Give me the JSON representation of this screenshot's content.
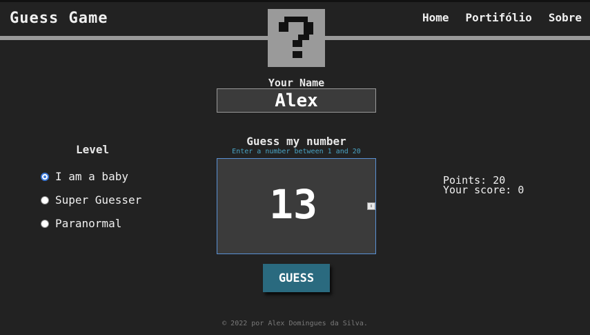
{
  "header": {
    "brand": "Guess Game",
    "logo_icon": "question-mark-icon",
    "nav": [
      {
        "label": "Home"
      },
      {
        "label": "Portifólio"
      },
      {
        "label": "Sobre"
      }
    ]
  },
  "name": {
    "label": "Your Name",
    "value": "Alex"
  },
  "level": {
    "title": "Level",
    "options": [
      {
        "label": "I am a baby",
        "checked": true
      },
      {
        "label": "Super Guesser",
        "checked": false
      },
      {
        "label": "Paranormal",
        "checked": false
      }
    ]
  },
  "guess": {
    "title": "Guess my number",
    "hint": "Enter a number between 1 and 20",
    "value": "13",
    "button_label": "GUESS"
  },
  "score": {
    "points_text": "Points: 20",
    "score_text": "Your score: 0"
  },
  "footer": {
    "text": "© 2022 por Alex Domingues da Silva."
  },
  "colors": {
    "background": "#222222",
    "bar": "#9a9a9a",
    "button": "#2a6a7f",
    "hint": "#4aa3c4",
    "input_border": "#5a92d6"
  }
}
